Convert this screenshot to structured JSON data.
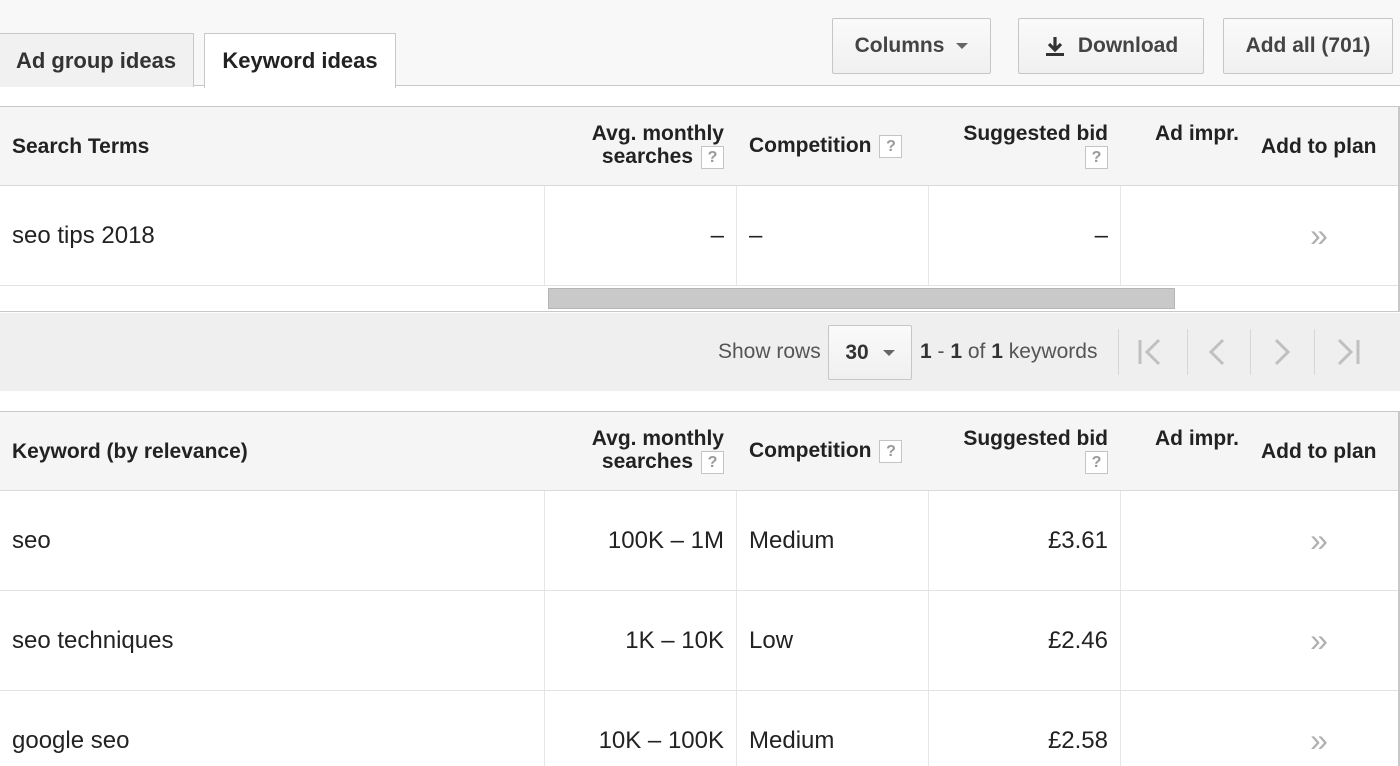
{
  "tabs": [
    {
      "label": "Ad group ideas",
      "active": false
    },
    {
      "label": "Keyword ideas",
      "active": true
    }
  ],
  "toolbar": {
    "columns_label": "Columns",
    "download_label": "Download",
    "add_all_label": "Add all (701)"
  },
  "search_table": {
    "headers": {
      "term": "Search Terms",
      "avg_line1": "Avg. monthly",
      "avg_line2": "searches",
      "competition": "Competition",
      "bid": "Suggested bid",
      "impr": "Ad impr.",
      "add": "Add to plan",
      "help": "?"
    },
    "rows": [
      {
        "term": "seo tips 2018",
        "avg": "–",
        "competition": "–",
        "bid": "–",
        "add": "»"
      }
    ]
  },
  "pager": {
    "show_rows_label": "Show rows",
    "rows_value": "30",
    "range_start": "1",
    "range_sep": " - ",
    "range_end": "1",
    "of_label": " of ",
    "total": "1",
    "unit_label": " keywords"
  },
  "keyword_table": {
    "headers": {
      "term": "Keyword (by relevance)",
      "avg_line1": "Avg. monthly",
      "avg_line2": "searches",
      "competition": "Competition",
      "bid": "Suggested bid",
      "impr": "Ad impr.",
      "add": "Add to plan",
      "help": "?"
    },
    "rows": [
      {
        "term": "seo",
        "avg": "100K – 1M",
        "competition": "Medium",
        "bid": "£3.61",
        "add": "»"
      },
      {
        "term": "seo techniques",
        "avg": "1K – 10K",
        "competition": "Low",
        "bid": "£2.46",
        "add": "»"
      },
      {
        "term": "google seo",
        "avg": "10K – 100K",
        "competition": "Medium",
        "bid": "£2.58",
        "add": "»"
      }
    ]
  }
}
